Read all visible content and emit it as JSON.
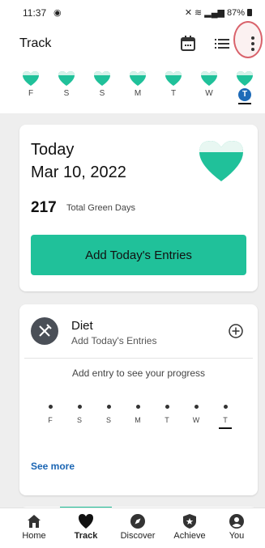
{
  "status_bar": {
    "time": "11:37",
    "battery": "87%"
  },
  "app_bar": {
    "title": "Track"
  },
  "week": [
    {
      "label": "F",
      "selected": false
    },
    {
      "label": "S",
      "selected": false
    },
    {
      "label": "S",
      "selected": false
    },
    {
      "label": "M",
      "selected": false
    },
    {
      "label": "T",
      "selected": false
    },
    {
      "label": "W",
      "selected": false
    },
    {
      "label": "T",
      "selected": true
    }
  ],
  "today": {
    "title": "Today",
    "date": "Mar 10, 2022",
    "green_days_count": "217",
    "green_days_label": "Total Green Days",
    "add_button": "Add Today's Entries"
  },
  "diet": {
    "title": "Diet",
    "subtitle": "Add Today's Entries",
    "progress_message": "Add entry to see your progress",
    "days": [
      "F",
      "S",
      "S",
      "M",
      "T",
      "W",
      "T"
    ],
    "see_more": "See more"
  },
  "nav": {
    "items": [
      {
        "label": "Home",
        "icon": "home-icon"
      },
      {
        "label": "Track",
        "icon": "heart-icon"
      },
      {
        "label": "Discover",
        "icon": "compass-icon"
      },
      {
        "label": "Achieve",
        "icon": "shield-star-icon"
      },
      {
        "label": "You",
        "icon": "person-icon"
      }
    ],
    "active": "Track"
  },
  "colors": {
    "accent_green": "#20c19a",
    "selected_blue": "#1e6bb8",
    "link_blue": "#1b65b3",
    "highlight_ring": "#d9626b"
  }
}
